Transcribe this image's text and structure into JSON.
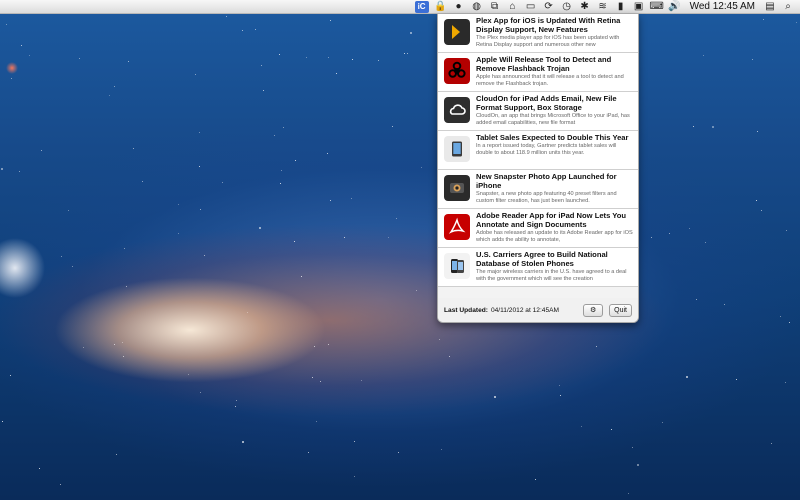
{
  "menubar": {
    "clock": "Wed 12:45 AM",
    "active_app_label": "iC"
  },
  "news": [
    {
      "title": "Plex App for iOS is Updated With Retina Display Support, New Features",
      "summary": "The Plex media player app for iOS has been updated with Retina Display support and numerous other new",
      "icon": "plex-icon",
      "color": "#2a2a2a",
      "accent": "#f0a800"
    },
    {
      "title": "Apple Will Release Tool to Detect and Remove Flashback Trojan",
      "summary": "Apple has announced that it will release a tool to detect and remove the Flashback trojan.",
      "icon": "biohazard-icon",
      "color": "#b40000",
      "accent": "#000000"
    },
    {
      "title": "CloudOn for iPad Adds Email, New File Format Support, Box Storage",
      "summary": "CloudOn, an app that brings Microsoft Office to your iPad, has added email capabilities, new file format",
      "icon": "cloud-icon",
      "color": "#2e2e2e",
      "accent": "#ffffff"
    },
    {
      "title": "Tablet Sales Expected to Double This Year",
      "summary": "In a report issued today, Gartner predicts tablet sales will double to about 118.9 million units this year.",
      "icon": "ipad-icon",
      "color": "#e9e9e9",
      "accent": "#3a3a3a"
    },
    {
      "title": "New Snapster Photo App Launched for iPhone",
      "summary": "Snapster, a new photo app featuring 40 preset filters and custom filter creation, has just been launched.",
      "icon": "camera-icon",
      "color": "#2b2b2b",
      "accent": "#d9a15a"
    },
    {
      "title": "Adobe Reader App for iPad Now Lets You Annotate and Sign Documents",
      "summary": "Adobe has released an update to its Adobe Reader app for iOS which adds the ability to annotate,",
      "icon": "adobe-reader-icon",
      "color": "#c70000",
      "accent": "#ffffff"
    },
    {
      "title": "U.S. Carriers Agree to Build National Database of Stolen Phones",
      "summary": "The major wireless carriers in the U.S. have agreed to a deal with the government which will see the creation",
      "icon": "iphone-icon",
      "color": "#f2f2f2",
      "accent": "#222222"
    }
  ],
  "footer": {
    "label": "Last Updated:",
    "value": "04/11/2012 at 12:45AM",
    "settings_icon": "gear-icon",
    "quit_label": "Quit"
  }
}
